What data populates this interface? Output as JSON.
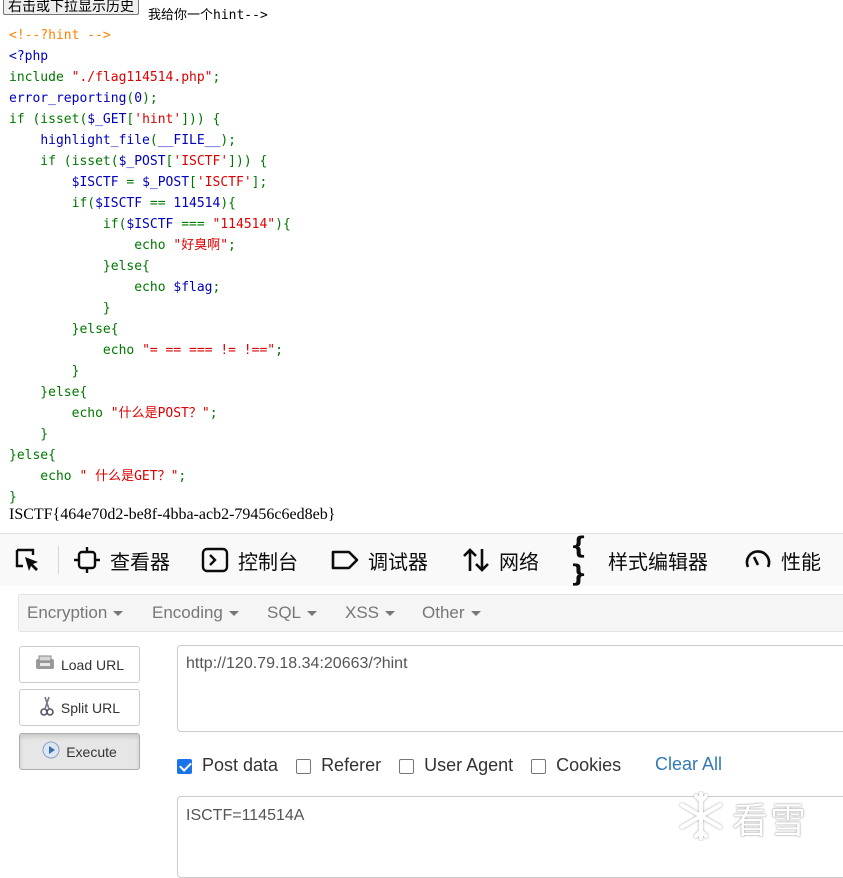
{
  "page": {
    "history_button": "右击或下拉显示历史",
    "hint_comment": "我给你一个hint-->",
    "code_lines": [
      [
        {
          "t": "<!--?hint -->",
          "c": "c-com"
        }
      ],
      [
        {
          "t": "<?php",
          "c": "c-def"
        }
      ],
      [
        {
          "t": "include ",
          "c": "c-kw"
        },
        {
          "t": "\"./flag114514.php\"",
          "c": "c-str"
        },
        {
          "t": ";",
          "c": "c-kw"
        }
      ],
      [
        {
          "t": "error_reporting",
          "c": "c-def"
        },
        {
          "t": "(",
          "c": "c-kw"
        },
        {
          "t": "0",
          "c": "c-def"
        },
        {
          "t": ");",
          "c": "c-kw"
        }
      ],
      [
        {
          "t": "if (isset(",
          "c": "c-kw"
        },
        {
          "t": "$_GET",
          "c": "c-def"
        },
        {
          "t": "[",
          "c": "c-kw"
        },
        {
          "t": "'hint'",
          "c": "c-str"
        },
        {
          "t": "])) {",
          "c": "c-kw"
        }
      ],
      [
        {
          "t": "    ",
          "c": "c-kw"
        },
        {
          "t": "highlight_file",
          "c": "c-def"
        },
        {
          "t": "(",
          "c": "c-kw"
        },
        {
          "t": "__FILE__",
          "c": "c-def"
        },
        {
          "t": ");",
          "c": "c-kw"
        }
      ],
      [
        {
          "t": "    if (isset(",
          "c": "c-kw"
        },
        {
          "t": "$_POST",
          "c": "c-def"
        },
        {
          "t": "[",
          "c": "c-kw"
        },
        {
          "t": "'ISCTF'",
          "c": "c-str"
        },
        {
          "t": "])) {",
          "c": "c-kw"
        }
      ],
      [
        {
          "t": "        ",
          "c": "c-kw"
        },
        {
          "t": "$ISCTF ",
          "c": "c-def"
        },
        {
          "t": "= ",
          "c": "c-kw"
        },
        {
          "t": "$_POST",
          "c": "c-def"
        },
        {
          "t": "[",
          "c": "c-kw"
        },
        {
          "t": "'ISCTF'",
          "c": "c-str"
        },
        {
          "t": "];",
          "c": "c-kw"
        }
      ],
      [
        {
          "t": "        if(",
          "c": "c-kw"
        },
        {
          "t": "$ISCTF ",
          "c": "c-def"
        },
        {
          "t": "== ",
          "c": "c-kw"
        },
        {
          "t": "114514",
          "c": "c-def"
        },
        {
          "t": "){",
          "c": "c-kw"
        }
      ],
      [
        {
          "t": "            if(",
          "c": "c-kw"
        },
        {
          "t": "$ISCTF ",
          "c": "c-def"
        },
        {
          "t": "=== ",
          "c": "c-kw"
        },
        {
          "t": "\"114514\"",
          "c": "c-str"
        },
        {
          "t": "){",
          "c": "c-kw"
        }
      ],
      [
        {
          "t": "                echo ",
          "c": "c-kw"
        },
        {
          "t": "\"好臭啊\"",
          "c": "c-str"
        },
        {
          "t": ";",
          "c": "c-kw"
        }
      ],
      [
        {
          "t": "            }else{",
          "c": "c-kw"
        }
      ],
      [
        {
          "t": "                echo ",
          "c": "c-kw"
        },
        {
          "t": "$flag",
          "c": "c-def"
        },
        {
          "t": ";",
          "c": "c-kw"
        }
      ],
      [
        {
          "t": "            }",
          "c": "c-kw"
        }
      ],
      [
        {
          "t": "        }else{",
          "c": "c-kw"
        }
      ],
      [
        {
          "t": "            echo ",
          "c": "c-kw"
        },
        {
          "t": "\"= == === != !==\"",
          "c": "c-str"
        },
        {
          "t": ";",
          "c": "c-kw"
        }
      ],
      [
        {
          "t": "        }",
          "c": "c-kw"
        }
      ],
      [
        {
          "t": "    }else{",
          "c": "c-kw"
        }
      ],
      [
        {
          "t": "        echo ",
          "c": "c-kw"
        },
        {
          "t": "\"什么是POST？\"",
          "c": "c-str"
        },
        {
          "t": ";",
          "c": "c-kw"
        }
      ],
      [
        {
          "t": "    }",
          "c": "c-kw"
        }
      ],
      [
        {
          "t": "}else{",
          "c": "c-kw"
        }
      ],
      [
        {
          "t": "    echo ",
          "c": "c-kw"
        },
        {
          "t": "\" 什么是GET？\"",
          "c": "c-str"
        },
        {
          "t": ";",
          "c": "c-kw"
        }
      ],
      [
        {
          "t": "}",
          "c": "c-kw"
        }
      ]
    ],
    "flag_output": "ISCTF{464e70d2-be8f-4bba-acb2-79456c6ed8eb}"
  },
  "devtools": {
    "tabs": [
      {
        "label": "查看器",
        "icon": "inspector-icon"
      },
      {
        "label": "控制台",
        "icon": "console-icon"
      },
      {
        "label": "调试器",
        "icon": "debugger-icon"
      },
      {
        "label": "网络",
        "icon": "network-icon"
      },
      {
        "label": "样式编辑器",
        "icon": "style-editor-icon"
      },
      {
        "label": "性能",
        "icon": "performance-icon"
      }
    ]
  },
  "hackbar": {
    "menus": [
      "Encryption",
      "Encoding",
      "SQL",
      "XSS",
      "Other"
    ],
    "load_url": "Load URL",
    "split_url": "Split URL",
    "execute": "Execute",
    "url_value": "http://120.79.18.34:20663/?hint",
    "options": [
      {
        "label": "Post data",
        "checked": true
      },
      {
        "label": "Referer",
        "checked": false
      },
      {
        "label": "User Agent",
        "checked": false
      },
      {
        "label": "Cookies",
        "checked": false
      }
    ],
    "clear_all": "Clear All",
    "post_value": "ISCTF=114514A"
  },
  "watermark": {
    "text": "看雪"
  },
  "colors": {
    "php_default": "#0000BB",
    "php_keyword": "#007700",
    "php_string": "#DD0000",
    "php_comment": "#FF8000",
    "link": "#337ab7",
    "checkbox": "#1a73e8"
  }
}
